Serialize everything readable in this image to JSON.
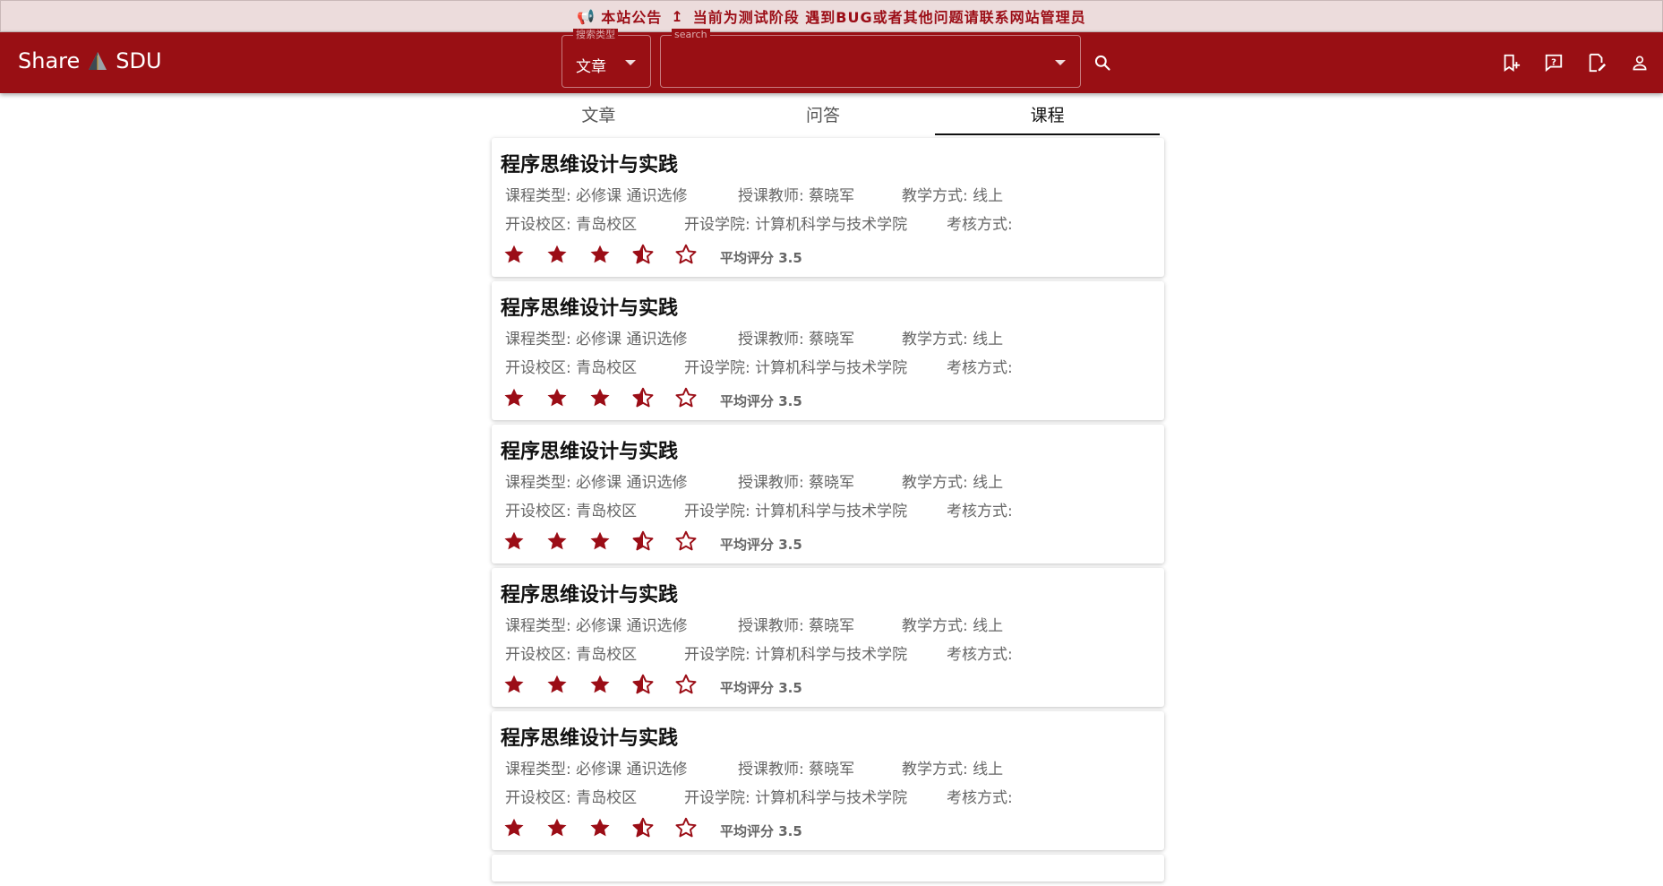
{
  "announcement": {
    "icon": "megaphone-icon",
    "label": "本站公告",
    "arrow": "↥",
    "text": "当前为测试阶段 遇到BUG或者其他问题请联系网站管理员"
  },
  "header": {
    "brand_left": "Share",
    "brand_right": "SDU",
    "search_type": {
      "label": "搜索类型",
      "value": "文章"
    },
    "search": {
      "label": "search",
      "value": "",
      "placeholder": ""
    },
    "icons": [
      "search-icon",
      "bookmark-add-icon",
      "question-icon",
      "edit-note-icon",
      "person-icon"
    ]
  },
  "tabs": [
    {
      "label": "文章",
      "active": false
    },
    {
      "label": "问答",
      "active": false
    },
    {
      "label": "课程",
      "active": true
    }
  ],
  "courses": [
    {
      "title": "程序思维设计与实践",
      "type": "课程类型: 必修课 通识选修",
      "teacher": "授课教师: 蔡晓军",
      "mode": "教学方式: 线上",
      "campus": "开设校区: 青岛校区",
      "college": "开设学院: 计算机科学与技术学院",
      "exam": "考核方式:",
      "rating": 3.5,
      "avg_label": "平均评分 3.5"
    },
    {
      "title": "程序思维设计与实践",
      "type": "课程类型: 必修课 通识选修",
      "teacher": "授课教师: 蔡晓军",
      "mode": "教学方式: 线上",
      "campus": "开设校区: 青岛校区",
      "college": "开设学院: 计算机科学与技术学院",
      "exam": "考核方式:",
      "rating": 3.5,
      "avg_label": "平均评分 3.5"
    },
    {
      "title": "程序思维设计与实践",
      "type": "课程类型: 必修课 通识选修",
      "teacher": "授课教师: 蔡晓军",
      "mode": "教学方式: 线上",
      "campus": "开设校区: 青岛校区",
      "college": "开设学院: 计算机科学与技术学院",
      "exam": "考核方式:",
      "rating": 3.5,
      "avg_label": "平均评分 3.5"
    },
    {
      "title": "程序思维设计与实践",
      "type": "课程类型: 必修课 通识选修",
      "teacher": "授课教师: 蔡晓军",
      "mode": "教学方式: 线上",
      "campus": "开设校区: 青岛校区",
      "college": "开设学院: 计算机科学与技术学院",
      "exam": "考核方式:",
      "rating": 3.5,
      "avg_label": "平均评分 3.5"
    },
    {
      "title": "程序思维设计与实践",
      "type": "课程类型: 必修课 通识选修",
      "teacher": "授课教师: 蔡晓军",
      "mode": "教学方式: 线上",
      "campus": "开设校区: 青岛校区",
      "college": "开设学院: 计算机科学与技术学院",
      "exam": "考核方式:",
      "rating": 3.5,
      "avg_label": "平均评分 3.5"
    }
  ],
  "colors": {
    "brand": "#990f14",
    "announce_bg": "#ecdcdc",
    "star": "#9b0d16"
  }
}
